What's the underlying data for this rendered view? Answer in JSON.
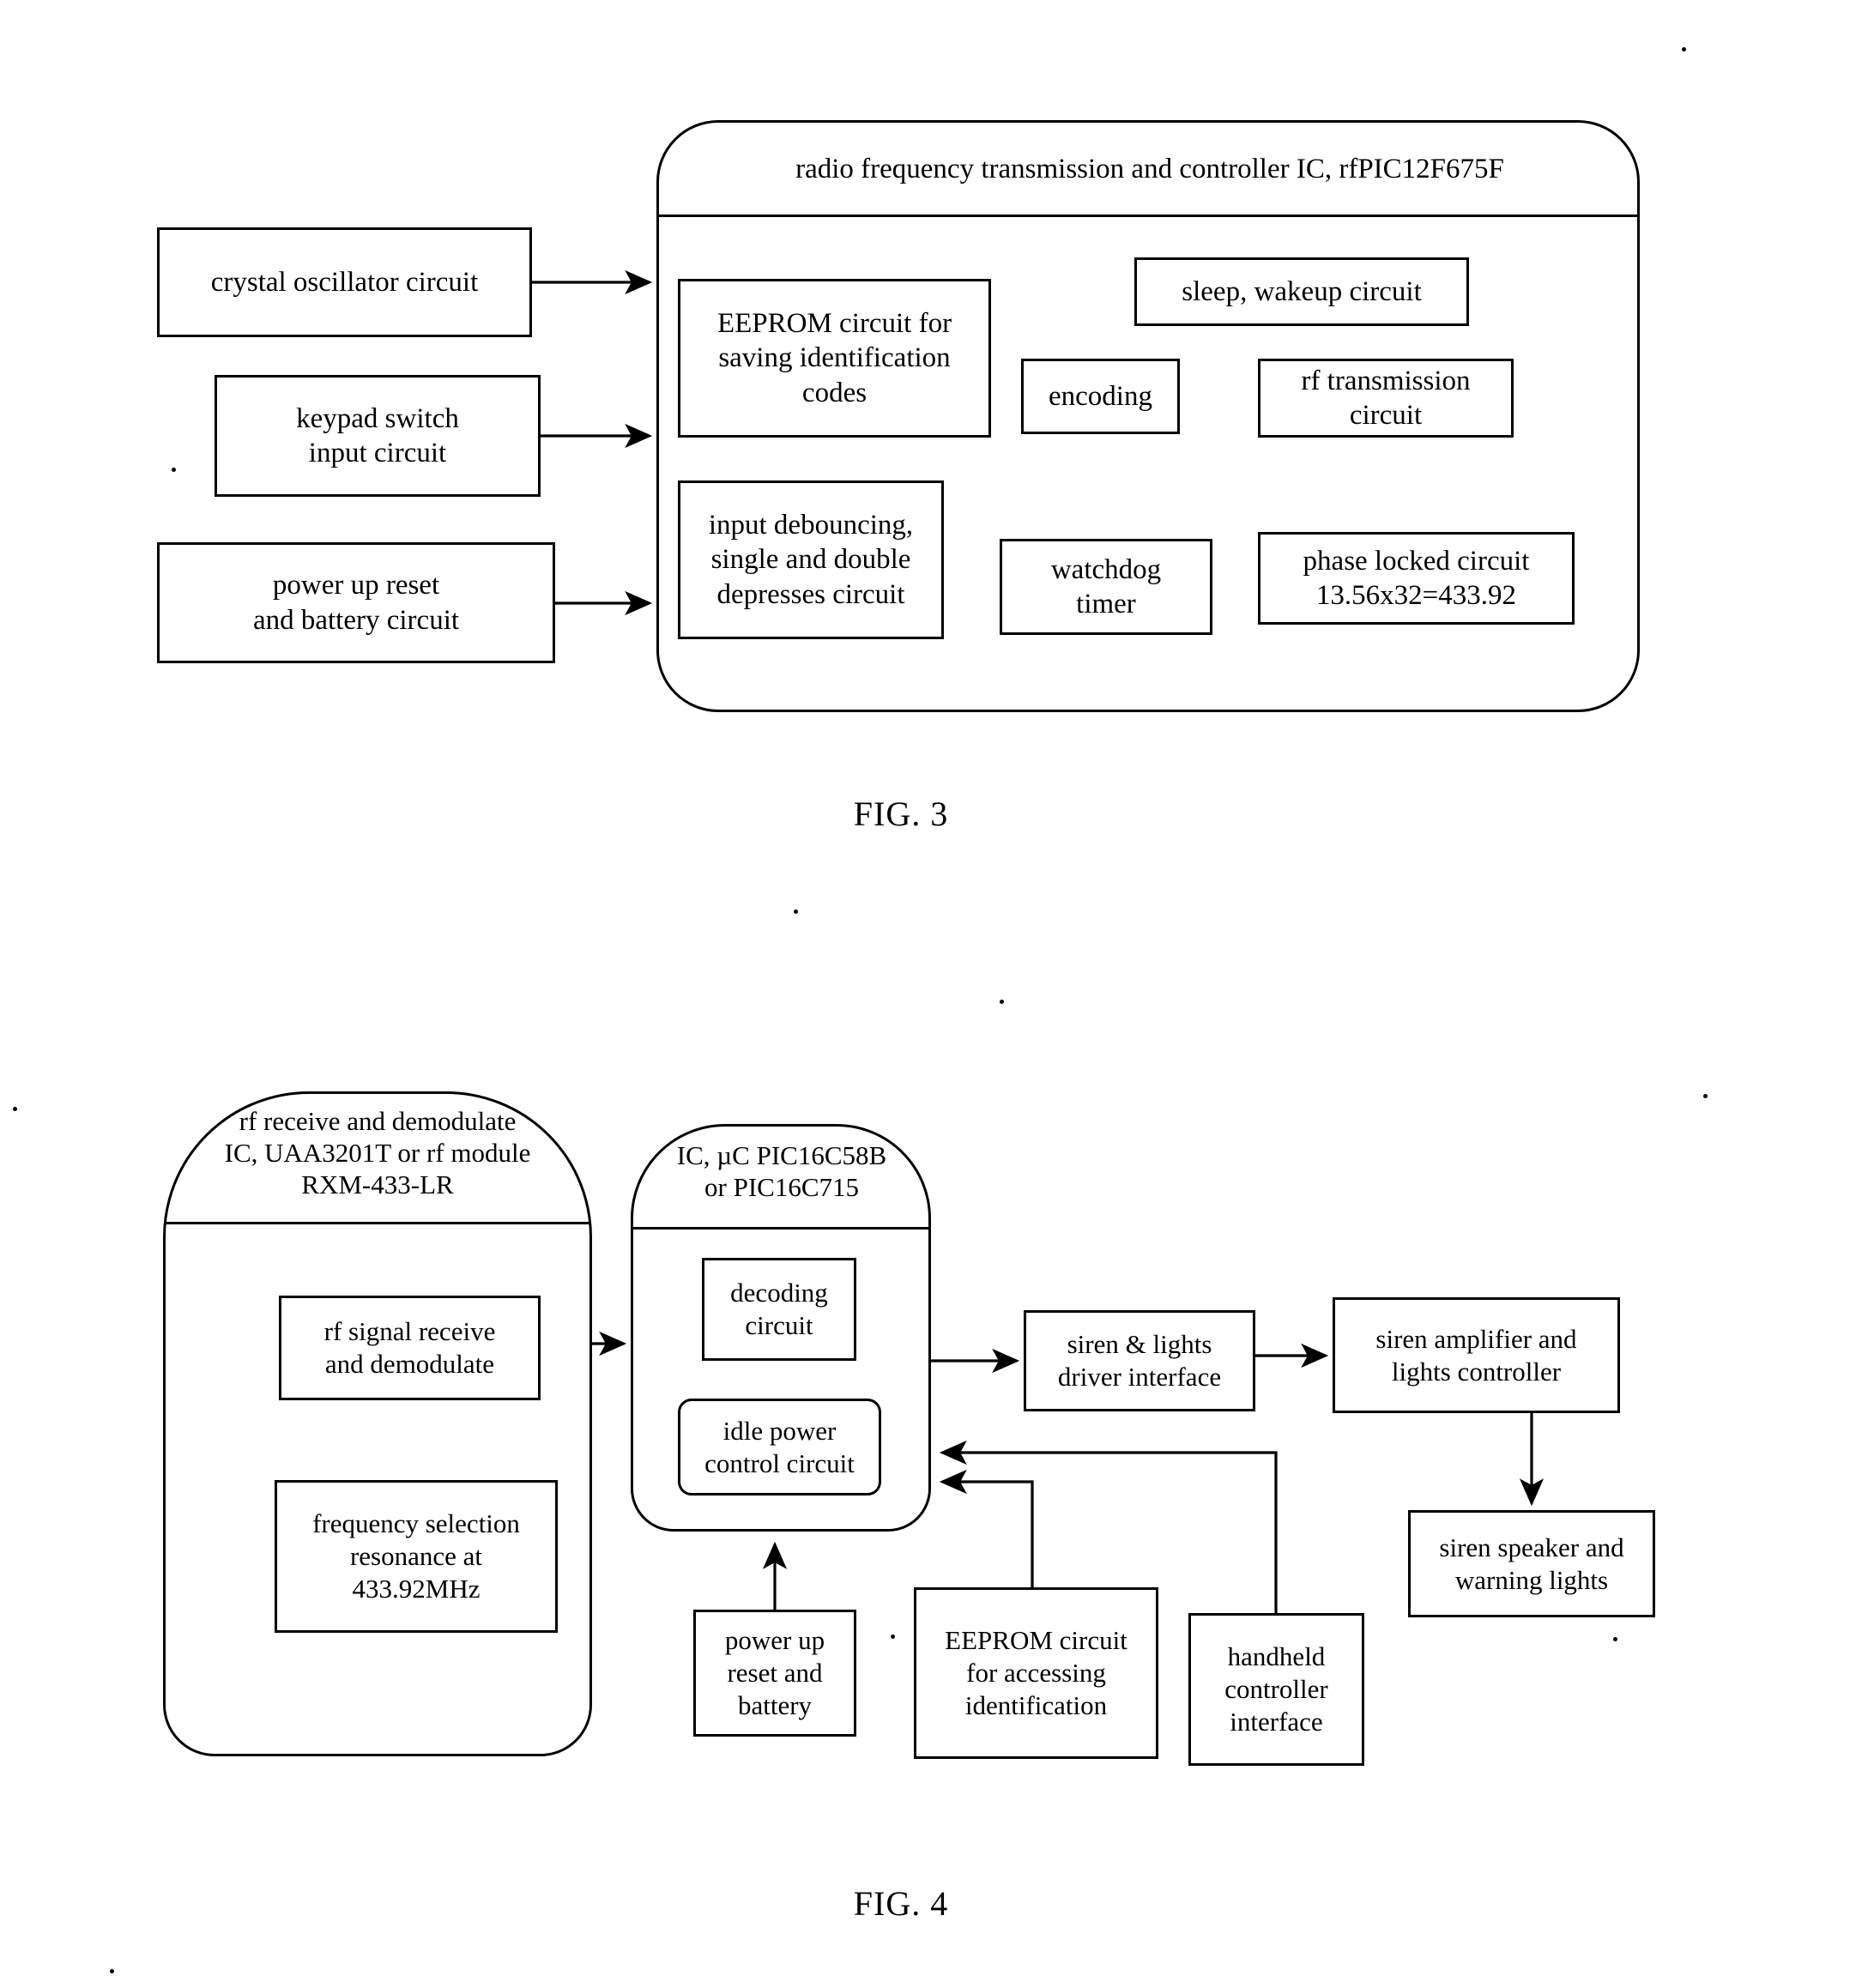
{
  "figures": [
    {
      "id": "fig3",
      "label": "FIG. 3",
      "container_title": "radio frequency transmission and controller IC, rfPIC12F675F",
      "external_blocks": [
        {
          "name": "crystal-oscillator-circuit",
          "text": "crystal oscillator circuit"
        },
        {
          "name": "keypad-switch-input-circuit",
          "text": "keypad switch\ninput circuit"
        },
        {
          "name": "power-up-reset-and-battery-circuit",
          "text": "power up reset\nand battery circuit"
        }
      ],
      "internal_blocks": [
        {
          "name": "eeprom-saving-identification-codes",
          "text": "EEPROM circuit for\nsaving identification\ncodes"
        },
        {
          "name": "sleep-wakeup-circuit",
          "text": "sleep, wakeup circuit"
        },
        {
          "name": "encoding",
          "text": "encoding"
        },
        {
          "name": "rf-transmission-circuit",
          "text": "rf transmission\ncircuit"
        },
        {
          "name": "input-debouncing-circuit",
          "text": "input debouncing,\nsingle and double\ndepresses circuit"
        },
        {
          "name": "watchdog-timer",
          "text": "watchdog\ntimer"
        },
        {
          "name": "phase-locked-circuit",
          "text": "phase locked circuit\n13.56x32=433.92"
        }
      ],
      "antenna": "antenna-icon"
    },
    {
      "id": "fig4",
      "label": "FIG. 4",
      "container_title_1": "rf receive and demodulate\nIC, UAA3201T or rf module\nRXM-433-LR",
      "container_title_2": "IC, µC PIC16C58B\nor PIC16C715",
      "blocks": [
        {
          "name": "rf-signal-receive-and-demodulate",
          "text": "rf signal receive\nand demodulate"
        },
        {
          "name": "frequency-selection-resonance",
          "text": "frequency selection\nresonance at\n433.92MHz"
        },
        {
          "name": "decoding-circuit",
          "text": "decoding\ncircuit"
        },
        {
          "name": "idle-power-control-circuit",
          "text": "idle power\ncontrol  circuit"
        },
        {
          "name": "siren-and-lights-driver-interface",
          "text": "siren & lights\ndriver interface"
        },
        {
          "name": "siren-amplifier-and-lights-controller",
          "text": "siren amplifier and\nlights controller"
        },
        {
          "name": "siren-speaker-and-warning-lights",
          "text": "siren speaker and\nwarning lights"
        },
        {
          "name": "power-up-reset-and-battery",
          "text": "power up\nreset and\nbattery"
        },
        {
          "name": "eeprom-circuit-for-accessing-identification",
          "text": "EEPROM circuit\nfor accessing\nidentification"
        },
        {
          "name": "handheld-controller-interface",
          "text": "handheld\ncontroller\ninterface"
        }
      ],
      "antenna": "antenna-icon"
    }
  ],
  "colors": {
    "ink": "#000000",
    "paper": "#ffffff"
  }
}
